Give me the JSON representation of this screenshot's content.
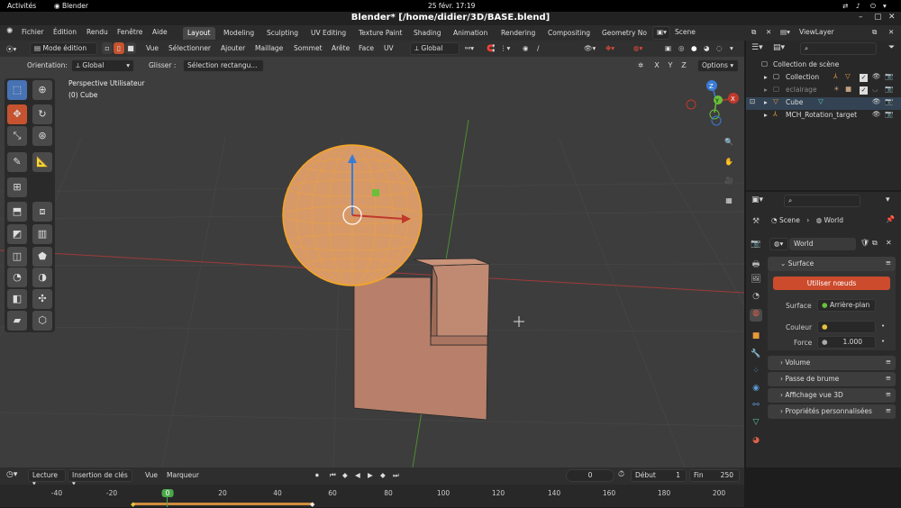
{
  "os": {
    "activities": "Activités",
    "app": "Blender",
    "datetime": "25 févr.  17:19"
  },
  "window": {
    "title": "Blender* [/home/didier/3D/BASE.blend]"
  },
  "menu": [
    "Fichier",
    "Édition",
    "Rendu",
    "Fenêtre",
    "Aide"
  ],
  "workspaces": [
    "Layout",
    "Modeling",
    "Sculpting",
    "UV Editing",
    "Texture Paint",
    "Shading",
    "Animation",
    "Rendering",
    "Compositing",
    "Geometry No"
  ],
  "scene_field": "Scene",
  "viewlayer_field": "ViewLayer",
  "viewport_header": {
    "mode": "Mode édition",
    "menus": [
      "Vue",
      "Sélectionner",
      "Ajouter",
      "Maillage",
      "Sommet",
      "Arête",
      "Face",
      "UV"
    ],
    "transform_orientation": "Global"
  },
  "tool_settings": {
    "orientation_label": "Orientation:",
    "orientation_value": "Global",
    "drag_label": "Glisser :",
    "drag_value": "Sélection rectangu...",
    "axes": [
      "X",
      "Y",
      "Z"
    ],
    "options": "Options"
  },
  "viewport": {
    "perspective": "Perspective Utilisateur",
    "object": "(0) Cube",
    "gizmo_axes": [
      "Z",
      "Y",
      "X"
    ]
  },
  "outliner": {
    "root": "Collection de scène",
    "items": [
      {
        "name": "Collection",
        "dim": false
      },
      {
        "name": "eclairage",
        "dim": true
      },
      {
        "name": "Cube",
        "dim": false
      },
      {
        "name": "MCH_Rotation_target",
        "dim": false
      }
    ]
  },
  "properties": {
    "breadcrumb": [
      "Scene",
      "World"
    ],
    "world_name": "World",
    "surface_panel": "Surface",
    "use_nodes": "Utiliser nœuds",
    "surface_label": "Surface",
    "surface_value": "Arrière-plan",
    "color_label": "Couleur",
    "strength_label": "Force",
    "strength_value": "1.000",
    "collapsed_panels": [
      "Volume",
      "Passe de brume",
      "Affichage vue 3D",
      "Propriétés personnalisées"
    ]
  },
  "timeline": {
    "playback": "Lecture",
    "keying": "Insertion de clés",
    "view": "Vue",
    "marker": "Marqueur",
    "current_frame": "0",
    "start_label": "Début",
    "start_value": "1",
    "end_label": "Fin",
    "end_value": "250",
    "ticks": [
      "-40",
      "-20",
      "0",
      "20",
      "40",
      "60",
      "80",
      "100",
      "120",
      "140",
      "160",
      "180",
      "200"
    ]
  },
  "colors": {
    "accent_blue": "#4772b3",
    "selection_orange": "#f5a623",
    "use_nodes_red": "#cc4b2c",
    "axis_red": "#c0392b",
    "axis_green": "#6bbf3a",
    "axis_blue": "#3a7bd5"
  }
}
